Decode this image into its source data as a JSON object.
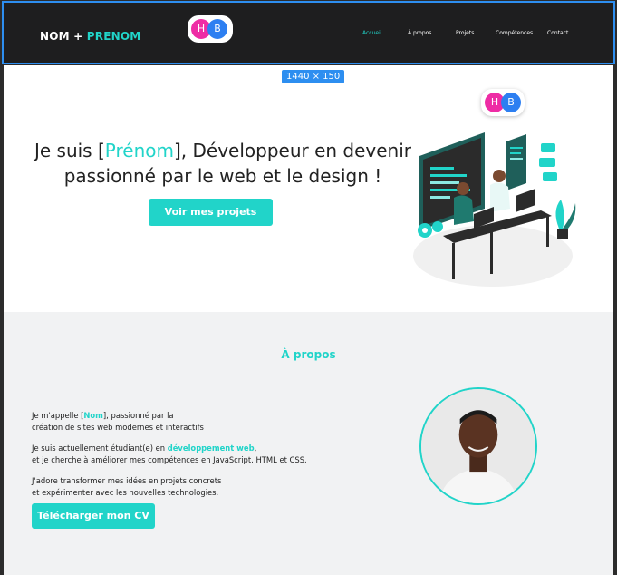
{
  "header": {
    "brand_part1": "NOM + ",
    "brand_part2": "PRENOM",
    "logo_letters": [
      "H",
      "B"
    ],
    "nav": [
      "Accueil",
      "À propos",
      "Projets",
      "Compétences",
      "Contact"
    ],
    "active_nav": "Accueil"
  },
  "size_badge": "1440 × 150",
  "hero": {
    "title_before": "Je suis [",
    "title_accent": "Prénom",
    "title_after": "], Développeur en devenir passionné par le web et le design !",
    "button": "Voir mes projets"
  },
  "about": {
    "title": "À propos",
    "p1_a": "Je m'appelle [",
    "p1_hl": "Nom",
    "p1_b": "], passionné par la",
    "p1_c": "création de sites web modernes et interactifs",
    "p2_a": "Je suis actuellement étudiant(e) en ",
    "p2_hl": "développement web",
    "p2_b": ",",
    "p2_c": "et je cherche à améliorer mes compétences en JavaScript, HTML et CSS.",
    "p3_a": "J'adore transformer mes idées en projets concrets",
    "p3_b": "et expérimenter avec les nouvelles technologies.",
    "cv_button": "Télécharger mon CV"
  },
  "colors": {
    "accent": "#21d4c9",
    "header_bg": "#1e1e1f",
    "selection": "#2d8ef0",
    "pink": "#ee2ca5",
    "blue": "#2d7ff1"
  }
}
